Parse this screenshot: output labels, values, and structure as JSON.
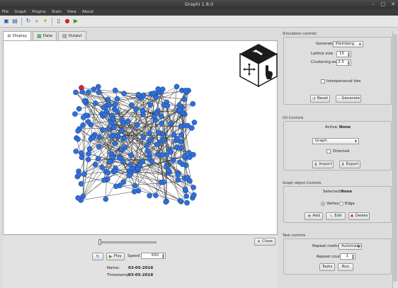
{
  "window": {
    "title": "Graphi 1.8.0"
  },
  "menus": [
    "File",
    "Graph",
    "Plugins",
    "Stats",
    "View",
    "About"
  ],
  "toolbar_icons": [
    "save-icon",
    "open-icon",
    "refresh-icon",
    "search-icon",
    "settings-icon",
    "pages-icon",
    "record-icon",
    "play-icon"
  ],
  "tabs": [
    {
      "label": "Display",
      "icon": "network-icon"
    },
    {
      "label": "Data",
      "icon": "grid-icon"
    },
    {
      "label": "Output",
      "icon": "document-icon"
    }
  ],
  "graph": {
    "vertex_color": "#2f6fd8",
    "highlight_color": "#e82020"
  },
  "playback": {
    "close_label": "Close",
    "play_label": "Play",
    "speed_label": "Speed",
    "speed_value": "500",
    "name_label": "Name:",
    "name_value": "03-05-2018",
    "timestamp_label": "Timestamp:",
    "timestamp_value": "03-05-2018"
  },
  "simulation": {
    "header": "Simulation controls",
    "generator_label": "Generator",
    "generator_value": "Kleinberg",
    "lattice_label": "Lattice size",
    "lattice_value": "15",
    "clustering_label": "Clustering exp.",
    "clustering_value": "2.5",
    "interpersonal_label": "Interpersonal ties",
    "reset_label": "Reset",
    "generate_label": "Generate"
  },
  "io": {
    "header": "I/O Controls",
    "active_label": "Active:",
    "active_value": "None",
    "type_value": "Graph",
    "directed_label": "Directed",
    "import_label": "Import",
    "export_label": "Export"
  },
  "graph_object": {
    "header": "Graph object Controls",
    "selected_label": "Selected:",
    "selected_value": "None",
    "vertex_label": "Vertex",
    "edge_label": "Edge",
    "add_label": "Add",
    "edit_label": "Edit",
    "delete_label": "Delete"
  },
  "tasks": {
    "header": "Task controls",
    "repeat_method_label": "Repeat method",
    "repeat_method_value": "Automatic",
    "repeat_count_label": "Repeat count",
    "repeat_count_value": "1",
    "tasks_label": "Tasks",
    "run_label": "Run"
  }
}
